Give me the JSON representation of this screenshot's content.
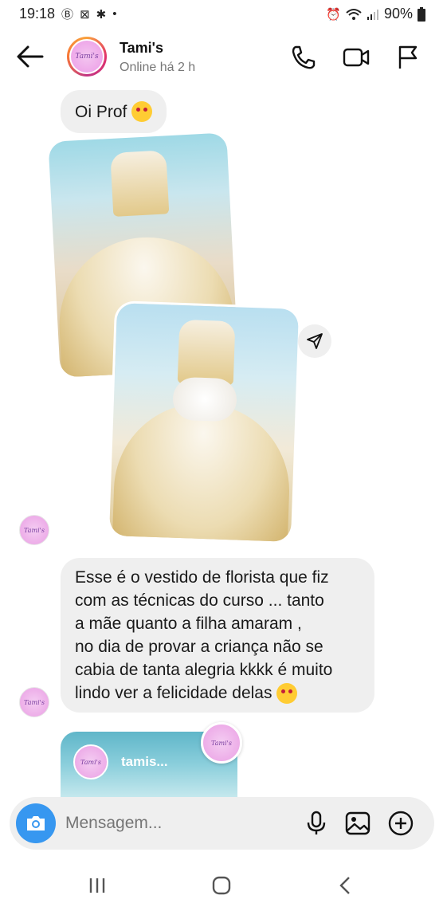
{
  "status_bar": {
    "time": "19:18",
    "battery": "90%",
    "left_icons": [
      "b-circle-icon",
      "bracket-icon",
      "bug-icon",
      "dot-icon"
    ],
    "right_icons": [
      "alarm-icon",
      "wifi-icon",
      "signal-icon",
      "battery-icon"
    ]
  },
  "header": {
    "name": "Tami's",
    "status": "Online há 2 h",
    "avatar_text": "Tami's"
  },
  "messages": {
    "greeting": "Oi Prof",
    "long_message_lines": [
      "Esse é o vestido de florista que fiz",
      "com as técnicas do curso ... tanto",
      "a mãe quanto a filha amaram ,",
      "no dia de provar a criança não se",
      "cabia de tanta alegria kkkk é muito",
      "lindo ver a felicidade delas"
    ],
    "shared_post_username": "tamis..."
  },
  "avatars": {
    "label": "Tami's"
  },
  "composer": {
    "placeholder": "Mensagem..."
  },
  "colors": {
    "accent": "#3797f0",
    "bubble": "#efefef",
    "muted_text": "#777777"
  }
}
